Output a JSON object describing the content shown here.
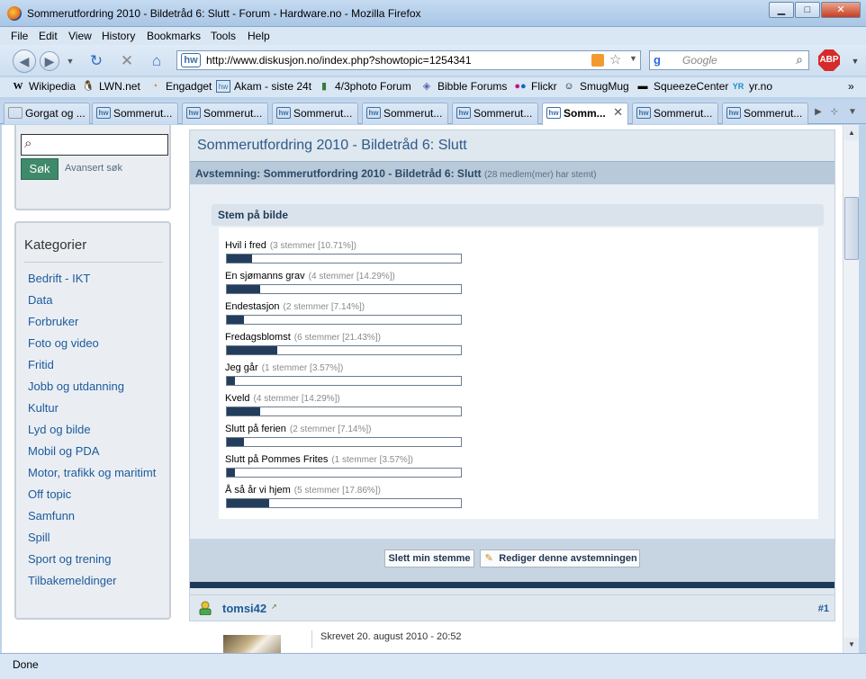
{
  "window": {
    "title": "Sommerutfordring 2010 - Bildetråd 6: Slutt - Forum - Hardware.no - Mozilla Firefox",
    "buttons": {
      "minimize": "▁",
      "maximize": "□",
      "close": "✕"
    }
  },
  "menu": [
    "File",
    "Edit",
    "View",
    "History",
    "Bookmarks",
    "Tools",
    "Help"
  ],
  "nav": {
    "url": "http://www.diskusjon.no/index.php?showtopic=1254341",
    "search_placeholder": "Google",
    "site_icon": "hw"
  },
  "bookmarks": [
    {
      "label": "Wikipedia",
      "icon": "wikipedia-icon"
    },
    {
      "label": "LWN.net",
      "icon": "tux-icon"
    },
    {
      "label": "Engadget",
      "icon": "feed-icon"
    },
    {
      "label": "Akam - siste 24t",
      "icon": "hw-icon"
    },
    {
      "label": "4/3photo Forum",
      "icon": "photo-icon"
    },
    {
      "label": "Bibble Forums",
      "icon": "bibble-icon"
    },
    {
      "label": "Flickr",
      "icon": "flickr-icon"
    },
    {
      "label": "SmugMug",
      "icon": "smugmug-icon"
    },
    {
      "label": "SqueezeCenter",
      "icon": "squeeze-icon"
    },
    {
      "label": "yr.no",
      "icon": "yr-icon"
    }
  ],
  "tabs": [
    {
      "label": "Gorgat og ...",
      "icon": ""
    },
    {
      "label": "Sommerut...",
      "icon": "hw"
    },
    {
      "label": "Sommerut...",
      "icon": "hw"
    },
    {
      "label": "Sommerut...",
      "icon": "hw"
    },
    {
      "label": "Sommerut...",
      "icon": "hw"
    },
    {
      "label": "Sommerut...",
      "icon": "hw"
    },
    {
      "label": "Somm...",
      "icon": "hw",
      "active": true
    },
    {
      "label": "Sommerut...",
      "icon": "hw"
    },
    {
      "label": "Sommerut...",
      "icon": "hw"
    }
  ],
  "sidebar": {
    "search_button": "Søk",
    "advanced_search": "Avansert søk",
    "categories_title": "Kategorier",
    "categories": [
      "Bedrift - IKT",
      "Data",
      "Forbruker",
      "Foto og video",
      "Fritid",
      "Jobb og utdanning",
      "Kultur",
      "Lyd og bilde",
      "Mobil og PDA",
      "Motor, trafikk og maritimt",
      "Off topic",
      "Samfunn",
      "Spill",
      "Sport og trening",
      "Tilbakemeldinger"
    ]
  },
  "topic": {
    "title": "Sommerutfordring 2010 - Bildetråd 6: Slutt",
    "poll_title": "Avstemning: Sommerutfordring 2010 - Bildetråd 6: Slutt",
    "poll_count": "(28 medlem(mer) har stemt)",
    "vote_header": "Stem på bilde",
    "options": [
      {
        "label": "Hvil i fred",
        "count": "(3 stemmer [10.71%])",
        "percent": 10.71
      },
      {
        "label": "En sjømanns grav",
        "count": "(4 stemmer [14.29%])",
        "percent": 14.29
      },
      {
        "label": "Endestasjon",
        "count": "(2 stemmer [7.14%])",
        "percent": 7.14
      },
      {
        "label": "Fredagsblomst",
        "count": "(6 stemmer [21.43%])",
        "percent": 21.43
      },
      {
        "label": "Jeg går",
        "count": "(1 stemmer [3.57%])",
        "percent": 3.57
      },
      {
        "label": "Kveld",
        "count": "(4 stemmer [14.29%])",
        "percent": 14.29
      },
      {
        "label": "Slutt på ferien",
        "count": "(2 stemmer [7.14%])",
        "percent": 7.14
      },
      {
        "label": "Slutt på Pommes Frites",
        "count": "(1 stemmer [3.57%])",
        "percent": 3.57
      },
      {
        "label": "Å så år vi hjem",
        "count": "(5 stemmer [17.86%])",
        "percent": 17.86
      }
    ],
    "delete_vote": "Slett min stemme",
    "edit_poll": "Rediger denne avstemningen"
  },
  "post": {
    "username": "tomsi42",
    "number": "#1",
    "written": "Skrevet 20. august 2010 - 20:52"
  },
  "status": "Done"
}
